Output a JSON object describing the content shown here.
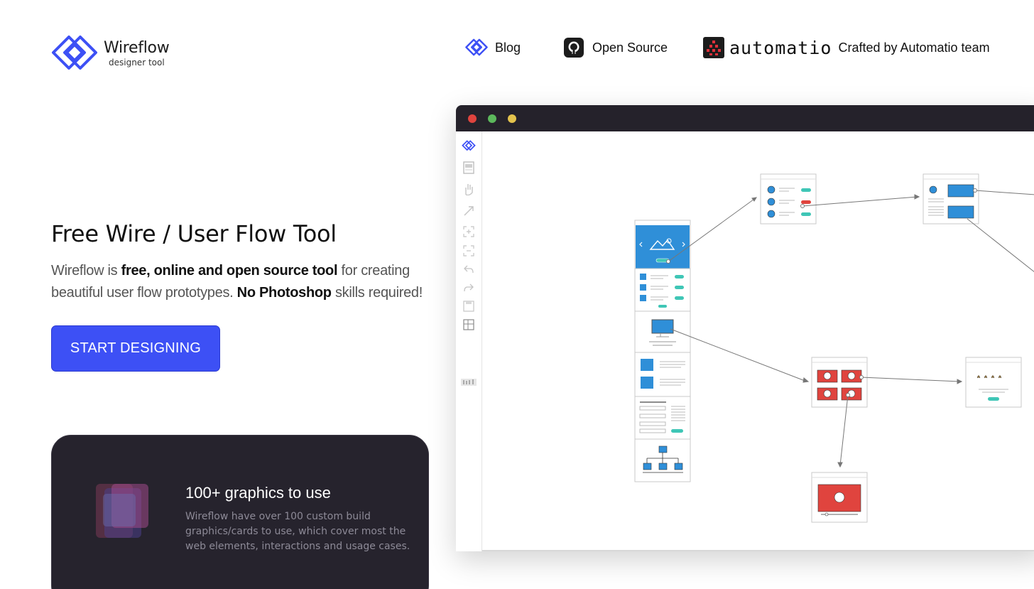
{
  "brand": {
    "name": "Wireflow",
    "tagline": "designer tool",
    "accent": "#3d50f5"
  },
  "nav": {
    "blog": "Blog",
    "open_source": "Open Source",
    "automatio_word": "automatio",
    "crafted": "Crafted by Automatio team"
  },
  "hero": {
    "title": "Free Wire / User Flow Tool",
    "desc_1": "Wireflow is ",
    "desc_2": "free, online and open source tool",
    "desc_3": " for creating beautiful user flow prototypes. ",
    "desc_4": "No Photoshop",
    "desc_5": " skills required!",
    "cta": "START DESIGNING"
  },
  "feature": {
    "title": "100+ graphics to use",
    "text": "Wireflow have over 100 custom build graphics/cards to use, which cover most the web elements, interactions and usage cases."
  },
  "app_window": {
    "controls": [
      "close",
      "minimize",
      "maximize"
    ],
    "toolbar_icons": [
      "wireflow-logo-icon",
      "cards-icon",
      "hand-icon",
      "arrow-icon",
      "zoom-in-icon",
      "zoom-out-icon",
      "undo-icon",
      "redo-icon",
      "save-icon",
      "export-icon",
      "stats-icon"
    ]
  }
}
